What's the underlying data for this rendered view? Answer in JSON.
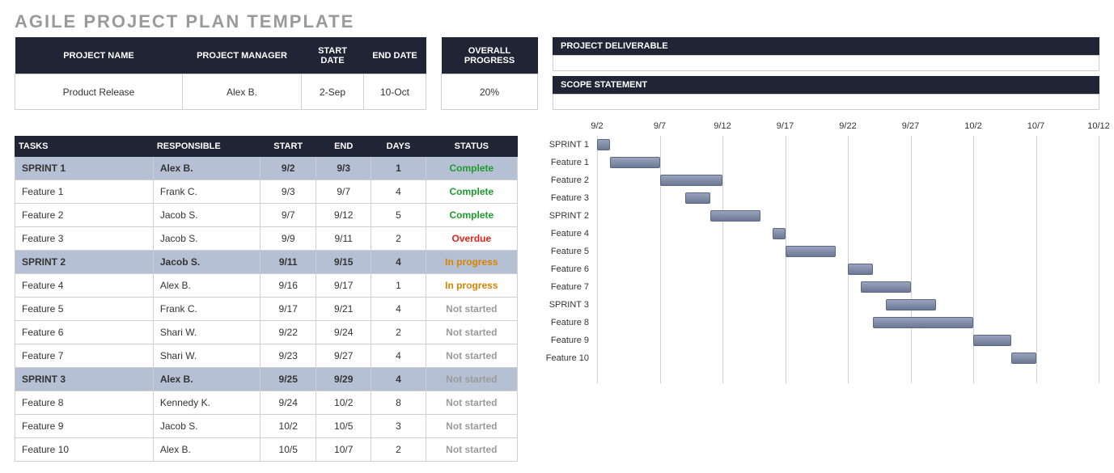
{
  "title": "AGILE PROJECT PLAN TEMPLATE",
  "meta": {
    "headers": {
      "project_name": "PROJECT NAME",
      "project_manager": "PROJECT MANAGER",
      "start_date": "START DATE",
      "end_date": "END DATE"
    },
    "values": {
      "project_name": "Product Release",
      "project_manager": "Alex B.",
      "start_date": "2-Sep",
      "end_date": "10-Oct"
    }
  },
  "overall": {
    "header": "OVERALL PROGRESS",
    "value": "20%"
  },
  "right_boxes": {
    "deliverable": "PROJECT DELIVERABLE",
    "scope": "SCOPE STATEMENT"
  },
  "task_headers": {
    "tasks": "TASKS",
    "responsible": "RESPONSIBLE",
    "start": "START",
    "end": "END",
    "days": "DAYS",
    "status": "STATUS"
  },
  "tasks": [
    {
      "sprint": true,
      "name": "SPRINT 1",
      "responsible": "Alex B.",
      "start": "9/2",
      "end": "9/3",
      "days": "1",
      "status": "Complete",
      "status_class": "st-complete"
    },
    {
      "sprint": false,
      "name": "Feature 1",
      "responsible": "Frank C.",
      "start": "9/3",
      "end": "9/7",
      "days": "4",
      "status": "Complete",
      "status_class": "st-complete"
    },
    {
      "sprint": false,
      "name": "Feature 2",
      "responsible": "Jacob S.",
      "start": "9/7",
      "end": "9/12",
      "days": "5",
      "status": "Complete",
      "status_class": "st-complete"
    },
    {
      "sprint": false,
      "name": "Feature 3",
      "responsible": "Jacob S.",
      "start": "9/9",
      "end": "9/11",
      "days": "2",
      "status": "Overdue",
      "status_class": "st-overdue"
    },
    {
      "sprint": true,
      "name": "SPRINT 2",
      "responsible": "Jacob S.",
      "start": "9/11",
      "end": "9/15",
      "days": "4",
      "status": "In progress",
      "status_class": "st-inprogress"
    },
    {
      "sprint": false,
      "name": "Feature 4",
      "responsible": "Alex B.",
      "start": "9/16",
      "end": "9/17",
      "days": "1",
      "status": "In progress",
      "status_class": "st-inprogress"
    },
    {
      "sprint": false,
      "name": "Feature 5",
      "responsible": "Frank C.",
      "start": "9/17",
      "end": "9/21",
      "days": "4",
      "status": "Not started",
      "status_class": "st-notstarted"
    },
    {
      "sprint": false,
      "name": "Feature 6",
      "responsible": "Shari W.",
      "start": "9/22",
      "end": "9/24",
      "days": "2",
      "status": "Not started",
      "status_class": "st-notstarted"
    },
    {
      "sprint": false,
      "name": "Feature 7",
      "responsible": "Shari W.",
      "start": "9/23",
      "end": "9/27",
      "days": "4",
      "status": "Not started",
      "status_class": "st-notstarted"
    },
    {
      "sprint": true,
      "name": "SPRINT 3",
      "responsible": "Alex B.",
      "start": "9/25",
      "end": "9/29",
      "days": "4",
      "status": "Not started",
      "status_class": "st-notstarted"
    },
    {
      "sprint": false,
      "name": "Feature 8",
      "responsible": "Kennedy K.",
      "start": "9/24",
      "end": "10/2",
      "days": "8",
      "status": "Not started",
      "status_class": "st-notstarted"
    },
    {
      "sprint": false,
      "name": "Feature 9",
      "responsible": "Jacob S.",
      "start": "10/2",
      "end": "10/5",
      "days": "3",
      "status": "Not started",
      "status_class": "st-notstarted"
    },
    {
      "sprint": false,
      "name": "Feature 10",
      "responsible": "Alex B.",
      "start": "10/5",
      "end": "10/7",
      "days": "2",
      "status": "Not started",
      "status_class": "st-notstarted"
    }
  ],
  "chart_data": {
    "type": "bar",
    "orientation": "horizontal-gantt",
    "x_ticks": [
      "9/2",
      "9/7",
      "9/12",
      "9/17",
      "9/22",
      "9/27",
      "10/2",
      "10/7",
      "10/12"
    ],
    "x_range_days": [
      0,
      40
    ],
    "rows": [
      {
        "name": "SPRINT 1",
        "start_day": 0,
        "duration": 1
      },
      {
        "name": "Feature 1",
        "start_day": 1,
        "duration": 4
      },
      {
        "name": "Feature 2",
        "start_day": 5,
        "duration": 5
      },
      {
        "name": "Feature 3",
        "start_day": 7,
        "duration": 2
      },
      {
        "name": "SPRINT 2",
        "start_day": 9,
        "duration": 4
      },
      {
        "name": "Feature 4",
        "start_day": 14,
        "duration": 1
      },
      {
        "name": "Feature 5",
        "start_day": 15,
        "duration": 4
      },
      {
        "name": "Feature 6",
        "start_day": 20,
        "duration": 2
      },
      {
        "name": "Feature 7",
        "start_day": 21,
        "duration": 4
      },
      {
        "name": "SPRINT 3",
        "start_day": 23,
        "duration": 4
      },
      {
        "name": "Feature 8",
        "start_day": 22,
        "duration": 8
      },
      {
        "name": "Feature 9",
        "start_day": 30,
        "duration": 3
      },
      {
        "name": "Feature 10",
        "start_day": 33,
        "duration": 2
      }
    ]
  }
}
